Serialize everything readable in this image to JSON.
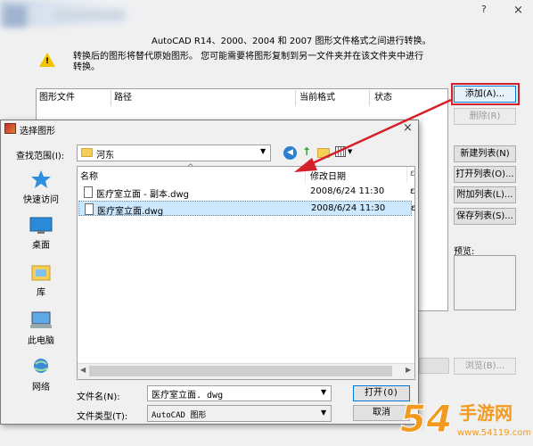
{
  "outer": {
    "help_glyph": "?",
    "close_glyph": "×",
    "description_line1": "AutoCAD R14、2000、2004 和 2007 图形文件格式之间进行转换。",
    "description_line2": "转换后的图形将替代原始图形。 您可能需要将图形复制到另一文件夹并在该文件夹中进行转换。",
    "columns": [
      "图形文件",
      "路径",
      "当前格式",
      "状态"
    ],
    "buttons": {
      "add": "添加(A)...",
      "remove": "删除(R)",
      "new_list": "新建列表(N)",
      "open_list": "打开列表(O)...",
      "append_list": "附加列表(L)...",
      "save_list": "保存列表(S)..."
    },
    "preview_label": "预览:",
    "browse_button": "浏览(B)..."
  },
  "dialog": {
    "title": "选择图形",
    "close_glyph": "×",
    "look_in_label": "查找范围(I):",
    "look_in_value": "河东",
    "places": [
      {
        "label": "快速访问",
        "icon": "star-icon"
      },
      {
        "label": "桌面",
        "icon": "desktop-icon"
      },
      {
        "label": "库",
        "icon": "library-icon"
      },
      {
        "label": "此电脑",
        "icon": "computer-icon"
      },
      {
        "label": "网络",
        "icon": "network-icon"
      }
    ],
    "file_columns": {
      "name": "名称",
      "modified": "修改日期",
      "type_clip": "ε"
    },
    "files": [
      {
        "name": "医疗室立面 - 副本.dwg",
        "modified": "2008/6/24 11:30",
        "clip": "ε",
        "selected": false
      },
      {
        "name": "医疗室立面.dwg",
        "modified": "2008/6/24 11:30",
        "clip": "ε",
        "selected": true
      }
    ],
    "filename_label": "文件名(N):",
    "filename_value": "医疗室立面. dwg",
    "filetype_label": "文件类型(T):",
    "filetype_value": "AutoCAD 图形",
    "open_button": "打开(O)",
    "cancel_button": "取消"
  },
  "watermark": {
    "main": "54",
    "suffix": "手游网",
    "url": "www.54119.com"
  },
  "colors": {
    "annotation": "#d4202a",
    "selection": "#cce8ff",
    "accent": "#0078d7"
  }
}
